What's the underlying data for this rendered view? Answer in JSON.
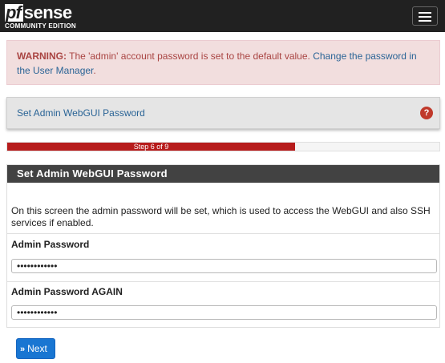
{
  "header": {
    "logo": {
      "part1": "pf",
      "part2": "sense",
      "subtitle": "COMMUNITY EDITION"
    },
    "menu_icon": "hamburger-menu-icon"
  },
  "alert": {
    "label": "WARNING:",
    "message": " The 'admin' account password is set to the default value. ",
    "link_text": "Change the password in the User Manager",
    "suffix": "."
  },
  "breadcrumb": {
    "title": "Set Admin WebGUI Password",
    "help_icon": "question-circle-icon"
  },
  "progress": {
    "label": "Step 6 of 9",
    "current": 6,
    "total": 9
  },
  "panel": {
    "title": "Set Admin WebGUI Password",
    "description": "On this screen the admin password will be set, which is used to access the WebGUI and also SSH services if enabled.",
    "fields": [
      {
        "label": "Admin Password",
        "value": "••••••••••••"
      },
      {
        "label": "Admin Password AGAIN",
        "value": "••••••••••••"
      }
    ]
  },
  "actions": {
    "next_label": "Next",
    "next_icon": "double-chevron-right-icon"
  },
  "colors": {
    "topbar": "#212121",
    "alert_bg": "#f2dede",
    "progress": "#b71c1c",
    "panel_head": "#424242",
    "primary": "#1976d2"
  }
}
